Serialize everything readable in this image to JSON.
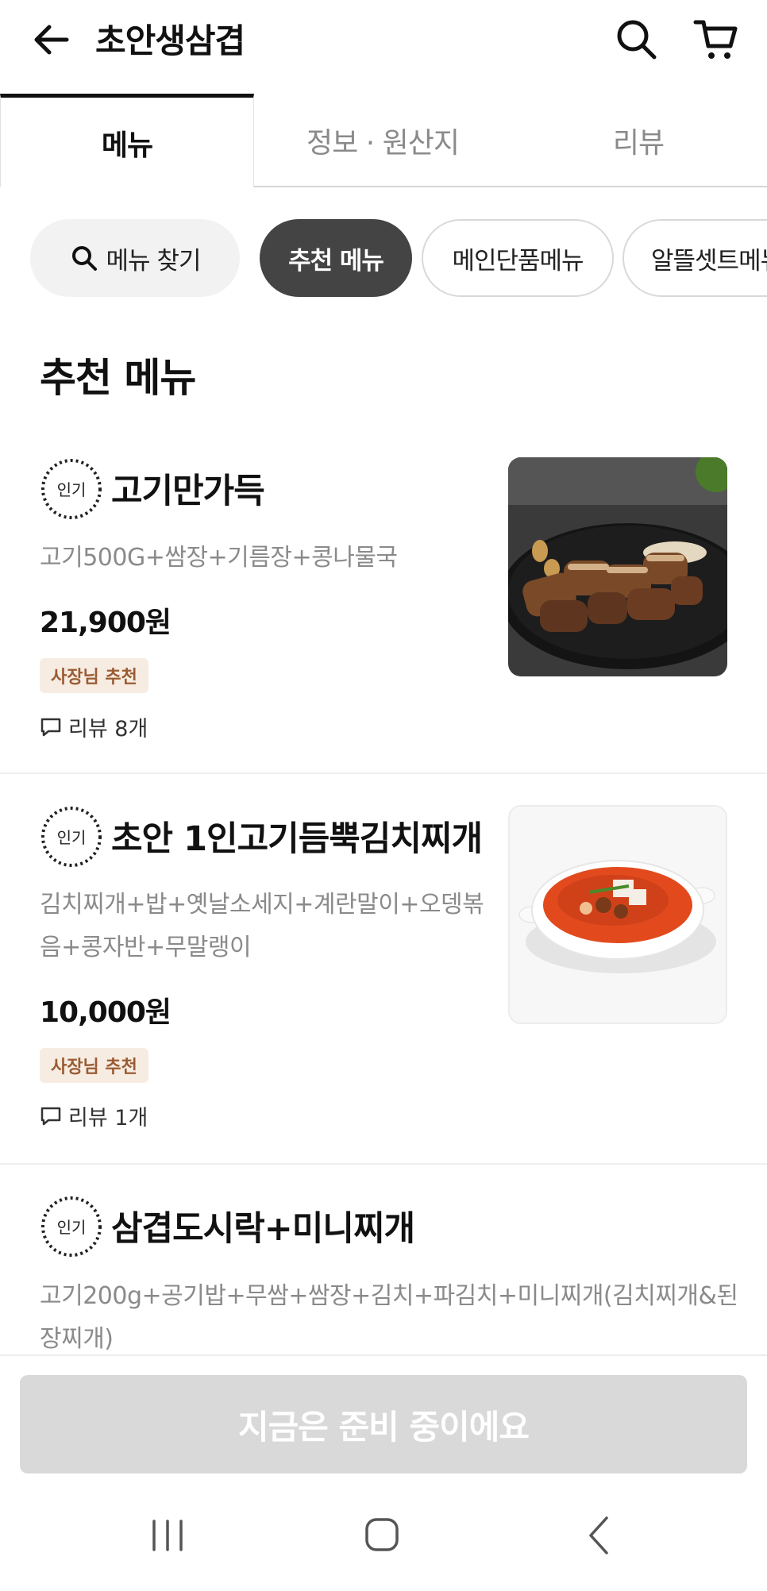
{
  "header": {
    "title": "초안생삼겹"
  },
  "tabs": [
    {
      "label": "메뉴"
    },
    {
      "label": "정보 · 원산지"
    },
    {
      "label": "리뷰"
    }
  ],
  "chips": {
    "search_label": "메뉴 찾기",
    "items": [
      "추천 메뉴",
      "메인단품메뉴",
      "알뜰셋트메뉴"
    ]
  },
  "section": {
    "title": "추천 메뉴"
  },
  "badge": {
    "label": "인기"
  },
  "menu_items": [
    {
      "name": "고기만가득",
      "description": "고기500G+쌈장+기름장+콩나물국",
      "price": "21,900원",
      "tag": "사장님 추천",
      "reviews": "리뷰 8개"
    },
    {
      "name": "초안 1인고기듬뿍김치찌개",
      "description": "김치찌개+밥+옛날소세지+계란말이+오뎅볶음+콩자반+무말랭이",
      "price": "10,000원",
      "tag": "사장님 추천",
      "reviews": "리뷰 1개"
    },
    {
      "name": "삼겹도시락+미니찌개",
      "description": "고기200g+공기밥+무쌈+쌈장+김치+파김치+미니찌개(김치찌개&된장찌개)"
    }
  ],
  "cta": {
    "label": "지금은 준비 중이에요"
  },
  "colors": {
    "accent_dark": "#444444",
    "tag_bg": "#f6ece2",
    "tag_text": "#9a5b33",
    "cta_disabled": "#d9d9d9"
  }
}
